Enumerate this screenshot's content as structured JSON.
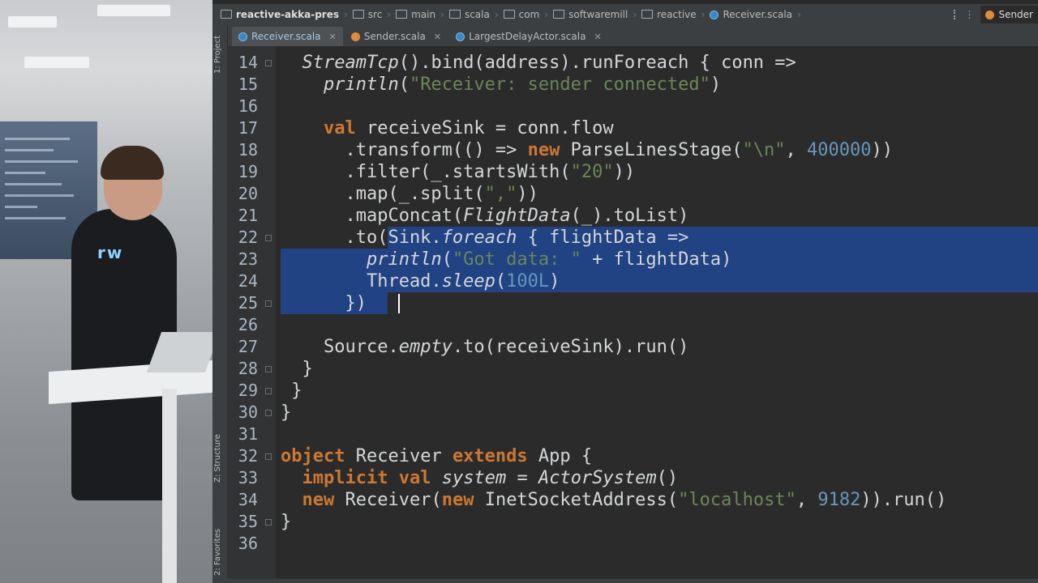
{
  "navbar": {
    "breadcrumbs": [
      "reactive-akka-pres",
      "src",
      "main",
      "scala",
      "com",
      "softwaremill",
      "reactive",
      "Receiver.scala"
    ],
    "right_label": "Sender"
  },
  "tabs": [
    {
      "label": "Receiver.scala",
      "active": true,
      "icon": "scala-file-icon"
    },
    {
      "label": "Sender.scala",
      "active": false,
      "icon": "scala-object-icon"
    },
    {
      "label": "LargestDelayActor.scala",
      "active": false,
      "icon": "scala-file-icon"
    }
  ],
  "tool_windows": {
    "project": "1: Project",
    "structure": "Z: Structure",
    "favorites": "2: Favorites"
  },
  "code_lines": [
    {
      "n": "14",
      "text": "  StreamTcp().bind(address).runForeach { conn =>"
    },
    {
      "n": "15",
      "text": "    println(\"Receiver: sender connected\")"
    },
    {
      "n": "16",
      "text": ""
    },
    {
      "n": "17",
      "text": "    val receiveSink = conn.flow"
    },
    {
      "n": "18",
      "text": "      .transform(() => new ParseLinesStage(\"\\n\", 400000))"
    },
    {
      "n": "19",
      "text": "      .filter(_.startsWith(\"20\"))"
    },
    {
      "n": "20",
      "text": "      .map(_.split(\",\"))"
    },
    {
      "n": "21",
      "text": "      .mapConcat(FlightData(_).toList)"
    },
    {
      "n": "22",
      "text": "      .to(Sink.foreach { flightData =>"
    },
    {
      "n": "23",
      "text": "        println(\"Got data: \" + flightData)"
    },
    {
      "n": "24",
      "text": "        Thread.sleep(100L)"
    },
    {
      "n": "25",
      "text": "      })"
    },
    {
      "n": "26",
      "text": ""
    },
    {
      "n": "27",
      "text": "    Source.empty.to(receiveSink).run()"
    },
    {
      "n": "28",
      "text": "  }"
    },
    {
      "n": "29",
      "text": " }"
    },
    {
      "n": "30",
      "text": "}"
    },
    {
      "n": "31",
      "text": ""
    },
    {
      "n": "32",
      "text": "object Receiver extends App {"
    },
    {
      "n": "33",
      "text": "  implicit val system = ActorSystem()"
    },
    {
      "n": "34",
      "text": "  new Receiver(new InetSocketAddress(\"localhost\", 9182)).run()"
    },
    {
      "n": "35",
      "text": "}"
    },
    {
      "n": "36",
      "text": ""
    }
  ],
  "colors": {
    "keyword": "#cc7832",
    "string": "#6a8759",
    "number": "#6897bb",
    "selection": "#214283",
    "editor_bg": "#2b2b2b"
  }
}
